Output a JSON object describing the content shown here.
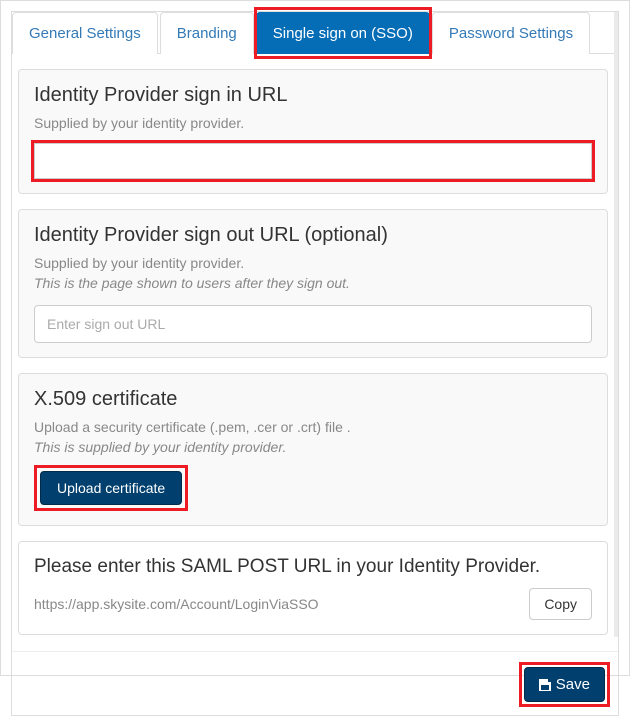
{
  "tabs": {
    "general": "General Settings",
    "branding": "Branding",
    "sso": "Single sign on (SSO)",
    "password": "Password Settings"
  },
  "signin": {
    "title": "Identity Provider sign in URL",
    "help": "Supplied by your identity provider.",
    "value": ""
  },
  "signout": {
    "title": "Identity Provider sign out URL (optional)",
    "help1": "Supplied by your identity provider.",
    "help2": "This is the page shown to users after they sign out.",
    "placeholder": "Enter sign out URL",
    "value": ""
  },
  "cert": {
    "title": "X.509 certificate",
    "help1": "Upload a security certificate (.pem, .cer or .crt) file .",
    "help2": "This is supplied by your identity provider.",
    "upload_label": "Upload certificate"
  },
  "saml": {
    "title": "Please enter this SAML POST URL in your Identity Provider.",
    "url": "https://app.skysite.com/Account/LoginViaSSO",
    "copy_label": "Copy"
  },
  "footer": {
    "save_label": "Save"
  }
}
